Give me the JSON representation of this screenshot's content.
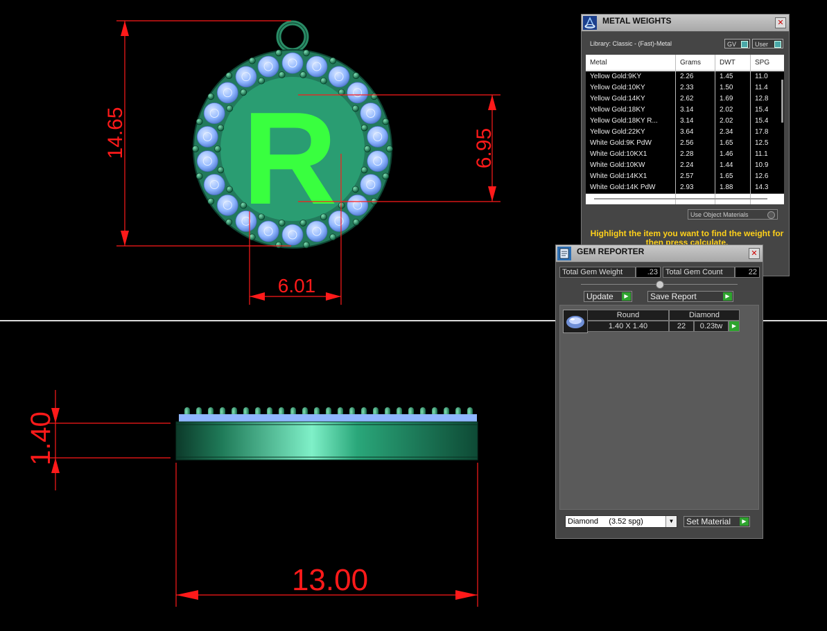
{
  "dimensions": {
    "height_top": "14.65",
    "letter_height": "6.95",
    "letter_width": "6.01",
    "thickness": "1.40",
    "width_side": "13.00"
  },
  "pendant": {
    "letter": "R"
  },
  "colors": {
    "dimension": "#ff1a1a",
    "metal": "#2a9d72",
    "letter": "#39ff3f",
    "stones": "#8fb6ff",
    "accent_green": "#2fa32f",
    "hint": "#ffd11a"
  },
  "metal_weights": {
    "title": "METAL WEIGHTS",
    "library": "Library: Classic - (Fast)-Metal",
    "toggle_gv": "GV",
    "toggle_user": "User",
    "columns": [
      "Metal",
      "Grams",
      "DWT",
      "SPG"
    ],
    "rows": [
      [
        "Yellow Gold:9KY",
        "2.26",
        "1.45",
        "11.0"
      ],
      [
        "Yellow Gold:10KY",
        "2.33",
        "1.50",
        "11.4"
      ],
      [
        "Yellow Gold:14KY",
        "2.62",
        "1.69",
        "12.8"
      ],
      [
        "Yellow Gold:18KY",
        "3.14",
        "2.02",
        "15.4"
      ],
      [
        "Yellow Gold:18KY R...",
        "3.14",
        "2.02",
        "15.4"
      ],
      [
        "Yellow Gold:22KY",
        "3.64",
        "2.34",
        "17.8"
      ],
      [
        "White Gold:9K PdW",
        "2.56",
        "1.65",
        "12.5"
      ],
      [
        "White Gold:10KX1",
        "2.28",
        "1.46",
        "11.1"
      ],
      [
        "White Gold:10KW",
        "2.24",
        "1.44",
        "10.9"
      ],
      [
        "White Gold:14KX1",
        "2.57",
        "1.65",
        "12.6"
      ],
      [
        "White Gold:14K PdW",
        "2.93",
        "1.88",
        "14.3"
      ]
    ],
    "use_object_materials": "Use Object Materials",
    "hint": "Highlight the item you want to find the weight for then press calculate."
  },
  "gem_reporter": {
    "title": "GEM REPORTER",
    "total_weight_label": "Total Gem Weight",
    "total_weight_value": ".23",
    "total_count_label": "Total Gem Count",
    "total_count_value": "22",
    "update_label": "Update",
    "save_report_label": "Save Report",
    "gem": {
      "shape": "Round",
      "material": "Diamond",
      "size": "1.40 X 1.40",
      "count": "22",
      "weight": "0.23tw"
    },
    "material_select": "Diamond     (3.52 spg)",
    "set_material_label": "Set Material"
  }
}
